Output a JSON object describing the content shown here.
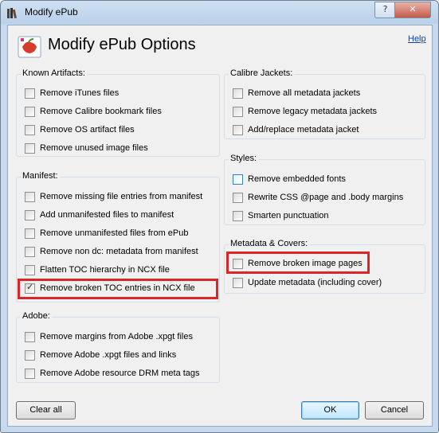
{
  "window": {
    "title": "Modify ePub",
    "help_btn": "?",
    "close_btn": "✕"
  },
  "header": {
    "title": "Modify ePub Options",
    "help_link": "Help"
  },
  "groups": {
    "known": {
      "title": "Known Artifacts:",
      "items": [
        {
          "label": "Remove iTunes files",
          "checked": false
        },
        {
          "label": "Remove Calibre bookmark files",
          "checked": false
        },
        {
          "label": "Remove OS artifact files",
          "checked": false
        },
        {
          "label": "Remove unused image files",
          "checked": false
        }
      ]
    },
    "manifest": {
      "title": "Manifest:",
      "items": [
        {
          "label": "Remove missing file entries from manifest",
          "checked": false
        },
        {
          "label": "Add unmanifested files to manifest",
          "checked": false
        },
        {
          "label": "Remove unmanifested files from ePub",
          "checked": false
        },
        {
          "label": "Remove non dc: metadata from manifest",
          "checked": false
        },
        {
          "label": "Flatten TOC hierarchy in NCX file",
          "checked": false
        },
        {
          "label": "Remove broken TOC entries in NCX file",
          "checked": true
        }
      ]
    },
    "adobe": {
      "title": "Adobe:",
      "items": [
        {
          "label": "Remove margins from Adobe .xpgt files",
          "checked": false
        },
        {
          "label": "Remove Adobe .xpgt files and links",
          "checked": false
        },
        {
          "label": "Remove Adobe resource DRM meta tags",
          "checked": false
        }
      ]
    },
    "jackets": {
      "title": "Calibre Jackets:",
      "items": [
        {
          "label": "Remove all metadata jackets",
          "checked": false
        },
        {
          "label": "Remove legacy metadata jackets",
          "checked": false
        },
        {
          "label": "Add/replace metadata jacket",
          "checked": false
        }
      ]
    },
    "styles": {
      "title": "Styles:",
      "items": [
        {
          "label": "Remove embedded fonts",
          "checked": false
        },
        {
          "label": "Rewrite CSS @page and .body margins",
          "checked": false
        },
        {
          "label": "Smarten punctuation",
          "checked": false
        }
      ]
    },
    "covers": {
      "title": "Metadata & Covers:",
      "items": [
        {
          "label": "Remove broken image pages",
          "checked": false
        },
        {
          "label": "Update metadata (including cover)",
          "checked": false
        }
      ]
    }
  },
  "buttons": {
    "clear_all": "Clear all",
    "ok": "OK",
    "cancel": "Cancel"
  },
  "colors": {
    "highlight_border": "#d9262b",
    "link": "#0645ad"
  }
}
